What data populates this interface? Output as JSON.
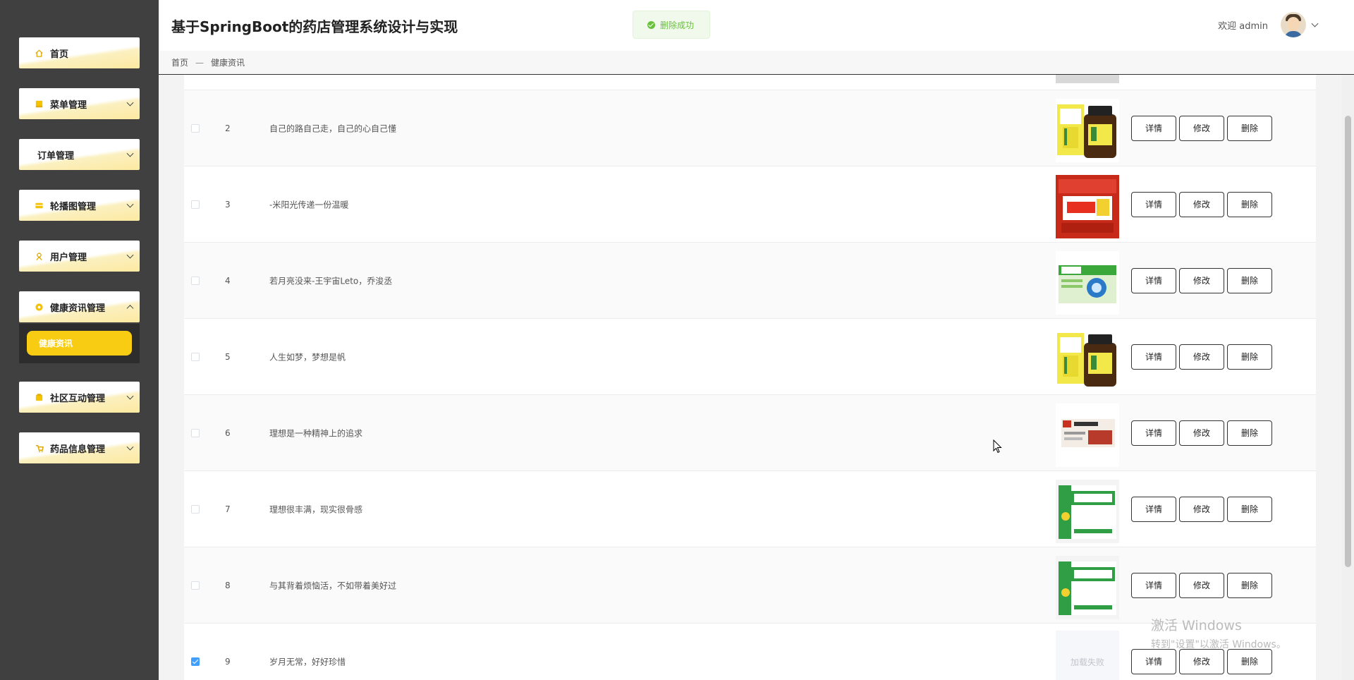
{
  "app": {
    "title": "基于SpringBoot的药店管理系统设计与实现"
  },
  "toast": {
    "message": "删除成功"
  },
  "user": {
    "welcome": "欢迎 admin"
  },
  "breadcrumb": {
    "home": "首页",
    "separator": "—",
    "current": "健康资讯"
  },
  "sidebar": {
    "items": [
      {
        "label": "首页",
        "icon": "home-icon"
      },
      {
        "label": "菜单管理",
        "icon": "menu-icon"
      },
      {
        "label": "订单管理",
        "icon": ""
      },
      {
        "label": "轮播图管理",
        "icon": "banner-icon"
      },
      {
        "label": "用户管理",
        "icon": "user-icon"
      },
      {
        "label": "健康资讯管理",
        "icon": "health-icon"
      },
      {
        "label": "社区互动管理",
        "icon": "community-icon"
      },
      {
        "label": "药品信息管理",
        "icon": "medicine-icon"
      }
    ],
    "submenu": {
      "label": "健康资讯"
    }
  },
  "table": {
    "buttons": {
      "detail": "详情",
      "edit": "修改",
      "delete": "删除"
    },
    "image_failed": "加载失败",
    "rows": [
      {
        "index": "2",
        "title": "自己的路自己走，自己的心自己懂",
        "image": "yellow-medicine-box-bottle",
        "checked": false
      },
      {
        "index": "3",
        "title": "-米阳光传递一份温暖",
        "image": "red-medicine-box",
        "checked": false
      },
      {
        "index": "4",
        "title": "若月亮没来-王宇宙Leto，乔浚丞",
        "image": "green-blue-medicine-box",
        "checked": false
      },
      {
        "index": "5",
        "title": "人生如梦，梦想是帆",
        "image": "yellow-medicine-box-bottle",
        "checked": false
      },
      {
        "index": "6",
        "title": "理想是一种精神上的追求",
        "image": "capsule-box",
        "checked": false
      },
      {
        "index": "7",
        "title": "理想很丰满，现实很骨感",
        "image": "green-white-medicine-box",
        "checked": false
      },
      {
        "index": "8",
        "title": "与其背着烦恼活，不如带着美好过",
        "image": "green-white-medicine-box",
        "checked": false
      },
      {
        "index": "9",
        "title": "岁月无常，好好珍惜",
        "image": "failed",
        "checked": true
      }
    ]
  },
  "watermark": {
    "line1": "激活 Windows",
    "line2": "转到\"设置\"以激活 Windows。"
  }
}
